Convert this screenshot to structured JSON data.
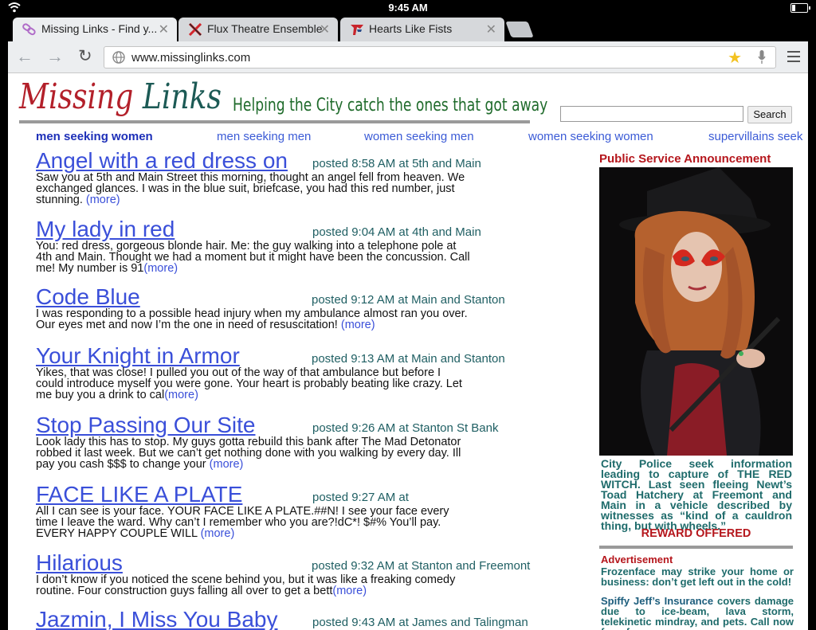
{
  "status": {
    "time": "9:45 AM"
  },
  "browser": {
    "tabs": [
      {
        "label": "Missing Links - Find y...",
        "icon": "chain-link-icon"
      },
      {
        "label": "Flux Theatre Ensemble",
        "icon": "flux-x-icon"
      },
      {
        "label": "Hearts Like Fists",
        "icon": "hlf-logo-icon"
      }
    ],
    "url": "www.missinglinks.com"
  },
  "site": {
    "logo_word1": "Missing",
    "logo_word2": "Links",
    "tagline": "Helping the City catch the ones that got away",
    "search_button": "Search",
    "categories": [
      "men seeking women",
      "men seeking men",
      "women seeking men",
      "women seeking women",
      "supervillains seek"
    ]
  },
  "posts": [
    {
      "title": "Angel with a red dress on",
      "meta": "posted 8:58 AM at 5th and Main",
      "body": "Saw you at 5th and Main Street this morning, thought an angel fell from heaven. We exchanged glances. I was in the blue suit, briefcase, you had this red number, just stunning. ",
      "more": "(more)"
    },
    {
      "title": "My lady in red",
      "meta": "posted 9:04 AM at 4th and Main",
      "body": "You: red dress, gorgeous blonde hair. Me: the guy walking into a telephone pole at 4th and Main. Thought we had a moment but it might have been the concussion. Call me! My number is 91",
      "more": "(more)"
    },
    {
      "title": "Code Blue",
      "meta": "posted 9:12 AM at Main and Stanton",
      "body": "I was responding to a possible head injury when my ambulance almost ran you over. Our eyes met and now I’m the one in need of resuscitation! ",
      "more": "(more)"
    },
    {
      "title": "Your Knight in Armor",
      "meta": "posted 9:13 AM at Main and Stanton",
      "body": "Yikes, that was close! I pulled you out of the way of that ambulance but before I could introduce myself you were gone. Your heart is probably beating like crazy. Let me buy you a drink to cal",
      "more": "(more)"
    },
    {
      "title": "Stop Passing Our Site",
      "meta": "posted 9:26 AM at Stanton St Bank",
      "body": "Look lady this has to stop. My guys gotta rebuild this bank after The Mad Detonator robbed it last week. But we can’t get nothing done with you walking by every day. Ill pay you cash $$$ to change your ",
      "more": "(more)"
    },
    {
      "title": "FACE LIKE A PLATE",
      "meta": "posted 9:27 AM at",
      "body": "All I can see is your face. YOUR FACE LIKE A PLATE.##N! I see your face every time I leave the ward. Why can’t I remember who you are?!dC*! $#% You’ll pay. EVERY HAPPY COUPLE WILL ",
      "more": "(more)"
    },
    {
      "title": "Hilarious",
      "meta": "posted 9:32 AM at Stanton and Freemont",
      "body": "I don’t know if you noticed the scene behind you, but it was like a freaking comedy routine. Four construction guys falling all over to get a bett",
      "more": "(more)"
    },
    {
      "title": "Jazmin, I Miss You Baby",
      "meta": "posted 9:43 AM at James and Talingman",
      "body": "",
      "more": ""
    }
  ],
  "sidebar": {
    "psa_heading": "Public Service Announcement",
    "psa_text": "City Police seek information leading to capture of THE RED WITCH. Last seen fleeing Newt’s Toad Hatchery at Freemont and Main in a vehicle described by witnesses as “kind of a cauldron thing, but with wheels.”",
    "reward": "REWARD OFFERED",
    "ad_heading": "Advertisement",
    "ad1": "Frozenface may strike your home or business: don’t get left out in the cold!",
    "ad2_brand": "Spiffy Jeff’s Insurance",
    "ad2_rest": " covers damage due to ice-beam, lava storm, telekinetic mindray, and pets. Call now for a free"
  },
  "colors": {
    "logo_red": "#b3202a",
    "logo_teal": "#1c5a55",
    "link_blue": "#3a4fd9",
    "meta_teal": "#1f5f63",
    "alert_red": "#b5161c"
  }
}
